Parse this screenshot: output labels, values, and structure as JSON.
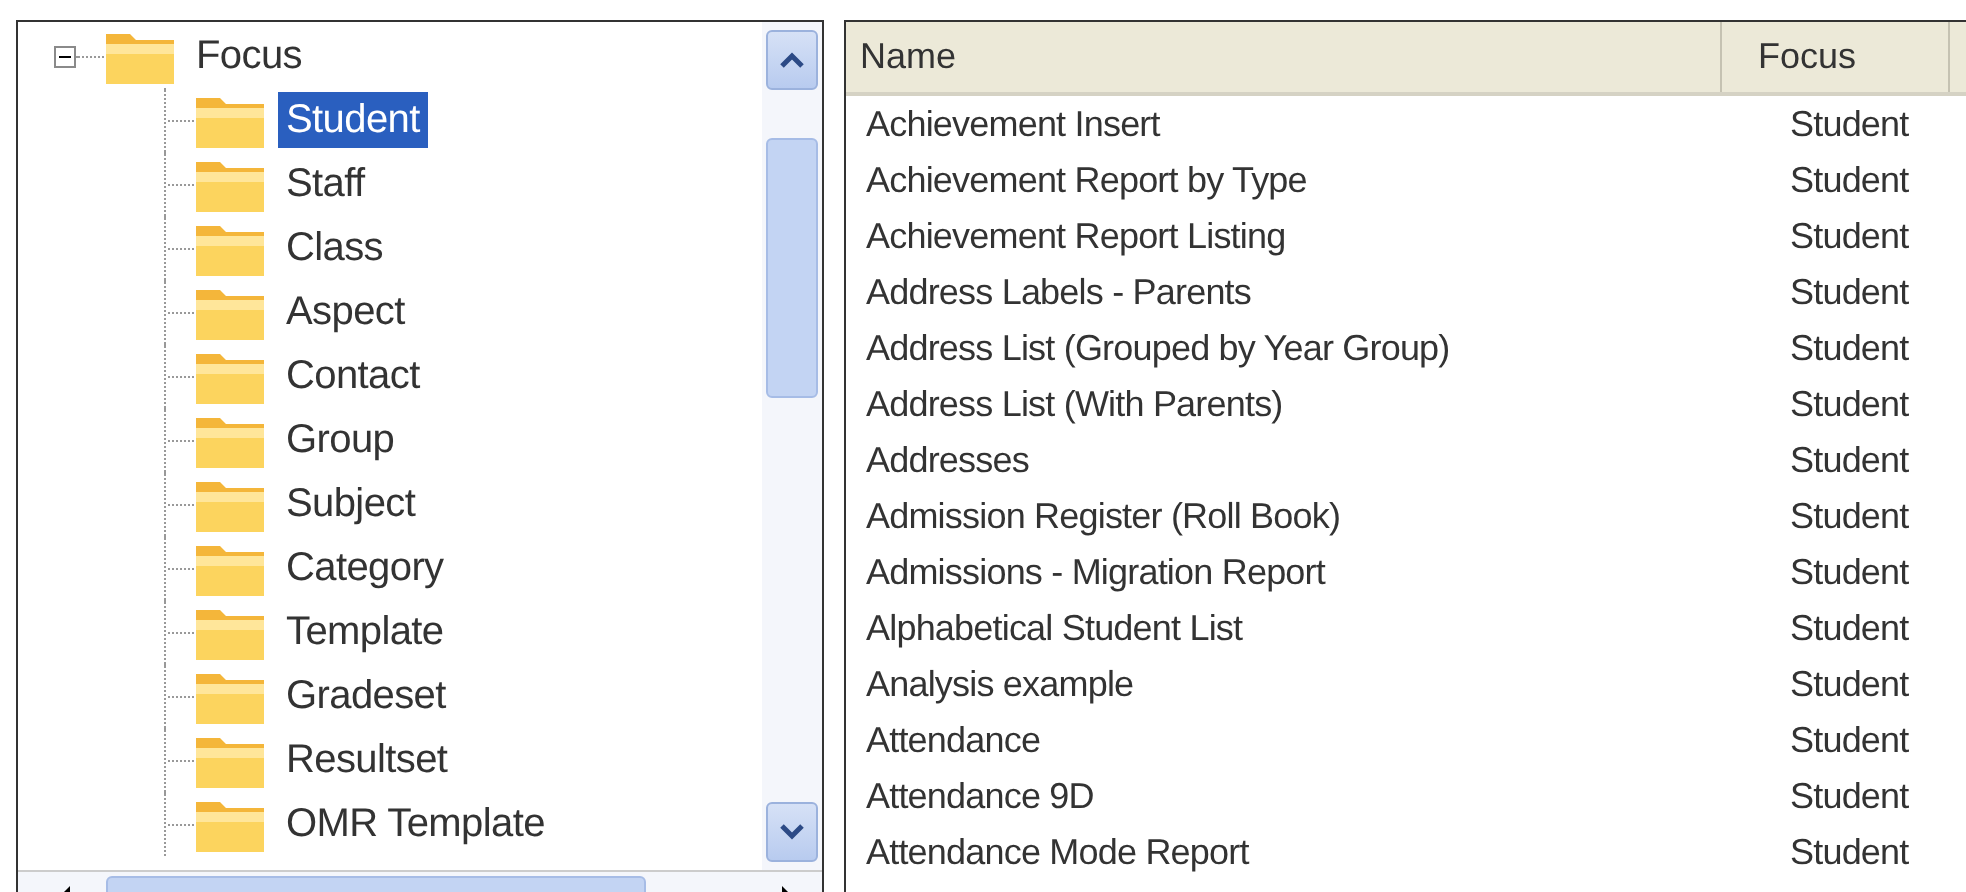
{
  "tree": {
    "label": "Focus",
    "expanded": true,
    "children": [
      {
        "label": "Student",
        "selected": true
      },
      {
        "label": "Staff",
        "selected": false
      },
      {
        "label": "Class",
        "selected": false
      },
      {
        "label": "Aspect",
        "selected": false
      },
      {
        "label": "Contact",
        "selected": false
      },
      {
        "label": "Group",
        "selected": false
      },
      {
        "label": "Subject",
        "selected": false
      },
      {
        "label": "Category",
        "selected": false
      },
      {
        "label": "Template",
        "selected": false
      },
      {
        "label": "Gradeset",
        "selected": false
      },
      {
        "label": "Resultset",
        "selected": false
      },
      {
        "label": "OMR Template",
        "selected": false
      }
    ]
  },
  "table": {
    "columns": [
      "Name",
      "Focus"
    ],
    "rows": [
      [
        "Achievement Insert",
        "Student"
      ],
      [
        "Achievement Report by Type",
        "Student"
      ],
      [
        "Achievement Report Listing",
        "Student"
      ],
      [
        "Address Labels - Parents",
        "Student"
      ],
      [
        "Address List (Grouped by Year Group)",
        "Student"
      ],
      [
        "Address List (With Parents)",
        "Student"
      ],
      [
        "Addresses",
        "Student"
      ],
      [
        "Admission Register (Roll Book)",
        "Student"
      ],
      [
        "Admissions - Migration Report",
        "Student"
      ],
      [
        "Alphabetical Student List",
        "Student"
      ],
      [
        "Analysis example",
        "Student"
      ],
      [
        "Attendance",
        "Student"
      ],
      [
        "Attendance 9D",
        "Student"
      ],
      [
        "Attendance Mode Report",
        "Student"
      ]
    ]
  }
}
